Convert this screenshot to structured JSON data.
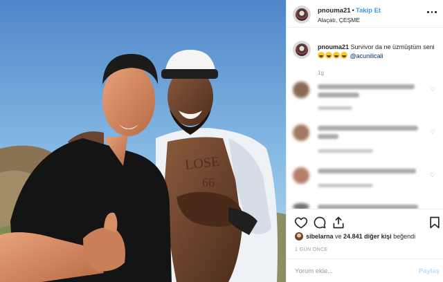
{
  "post": {
    "username": "pnouma21",
    "follow_label": "Takip Et",
    "location": "Alaçatı, ÇEŞME",
    "caption_text": "Survivor da ne üzmüştüm seni",
    "caption_mention": "@acunilicali",
    "caption_time": "1g",
    "liked_by_user": "sibelarna",
    "likes_text_mid": " ve ",
    "likes_count": "24.841 diğer kişi",
    "likes_text_end": " beğendi",
    "time_ago": "1 GÜN ÖNCE",
    "comment_placeholder": "Yorum ekle...",
    "post_label": "Paylaş"
  },
  "icons": {
    "more": "more-options-icon",
    "like": "heart-icon",
    "comment": "comment-bubble-icon",
    "share": "share-arrow-icon",
    "save": "bookmark-icon"
  },
  "colors": {
    "accent": "#3897f0",
    "sky": "#7fb2e0",
    "post_disabled": "#b2dffc"
  }
}
